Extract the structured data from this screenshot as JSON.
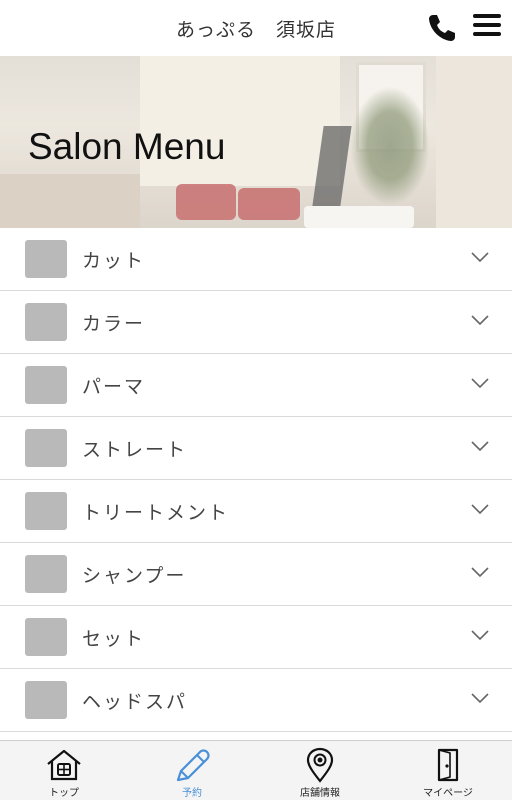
{
  "header": {
    "title": "あっぷる　須坂店",
    "phone_icon": "phone-icon",
    "menu_icon": "hamburger-menu-icon"
  },
  "hero": {
    "title": "Salon Menu"
  },
  "menu": {
    "items": [
      {
        "label": "カット"
      },
      {
        "label": "カラー"
      },
      {
        "label": "パーマ"
      },
      {
        "label": "ストレート"
      },
      {
        "label": "トリートメント"
      },
      {
        "label": "シャンプー"
      },
      {
        "label": "セット"
      },
      {
        "label": "ヘッドスパ"
      }
    ]
  },
  "tabbar": {
    "tabs": [
      {
        "label": "トップ",
        "icon": "home-icon"
      },
      {
        "label": "予約",
        "icon": "pencil-icon",
        "active": true
      },
      {
        "label": "店舗情報",
        "icon": "map-pin-icon"
      },
      {
        "label": "マイページ",
        "icon": "door-icon"
      }
    ],
    "active_color": "#4a90d9"
  }
}
